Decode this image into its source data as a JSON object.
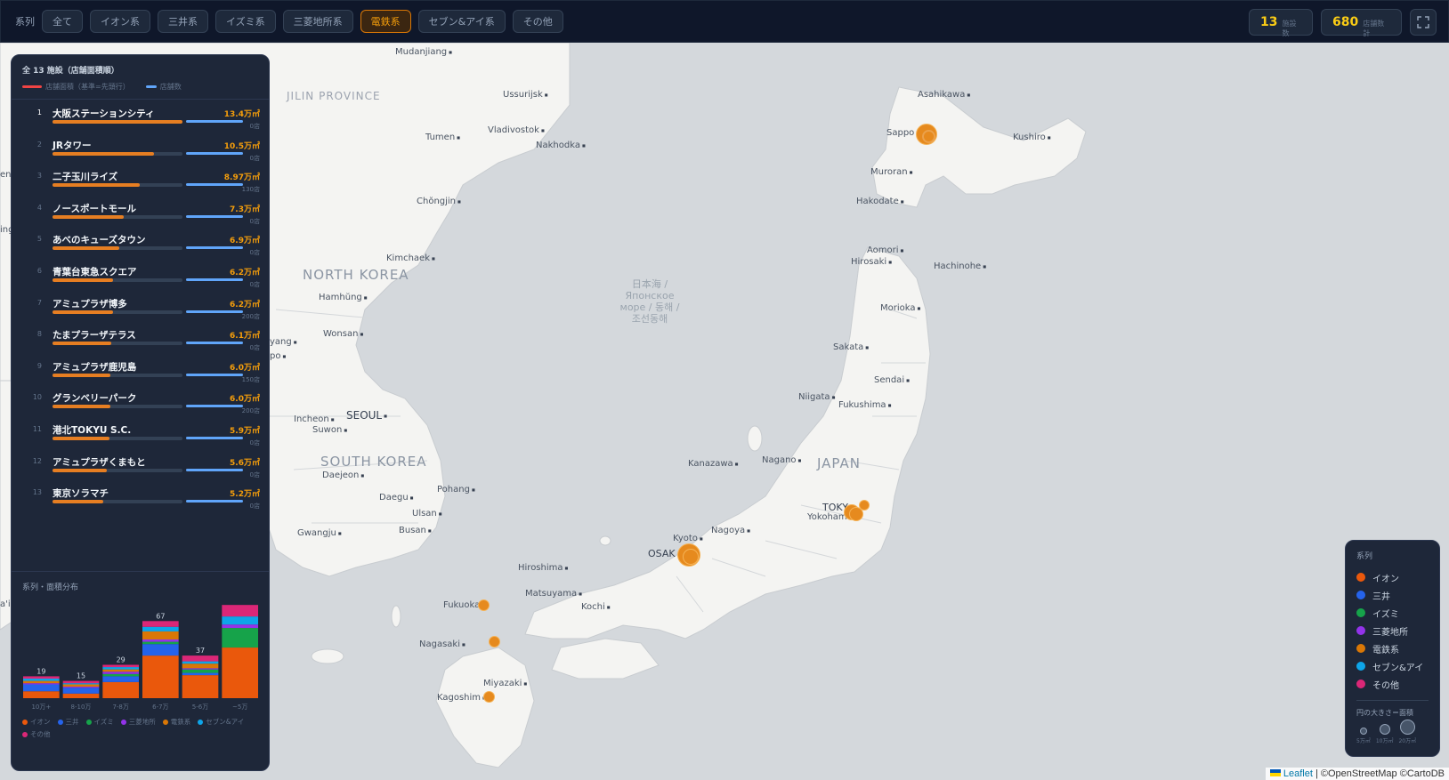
{
  "toolbar": {
    "series_label": "系列",
    "filters": [
      "全て",
      "イオン系",
      "三井系",
      "イズミ系",
      "三菱地所系",
      "電鉄系",
      "セブン&アイ系",
      "その他"
    ],
    "active_filter": "電鉄系",
    "facilities_value": "13",
    "facilities_unit": "施設数",
    "shops_value": "680",
    "shops_unit": "店舗数計",
    "fullscreen_icon": "fullscreen-icon"
  },
  "panel": {
    "title": "全 13 施設（店舗面積順）",
    "legend_area": "店舗面積（基準=先頭行）",
    "legend_shops": "店舗数",
    "items": [
      {
        "rank": "1",
        "name": "大阪ステーションシティ",
        "area": "13.4万㎡",
        "shops": "0店",
        "area_value": 13.4
      },
      {
        "rank": "2",
        "name": "JRタワー",
        "area": "10.5万㎡",
        "shops": "0店",
        "area_value": 10.5
      },
      {
        "rank": "3",
        "name": "二子玉川ライズ",
        "area": "8.97万㎡",
        "shops": "130店",
        "area_value": 8.97
      },
      {
        "rank": "4",
        "name": "ノースポートモール",
        "area": "7.3万㎡",
        "shops": "0店",
        "area_value": 7.3
      },
      {
        "rank": "5",
        "name": "あべのキューズタウン",
        "area": "6.9万㎡",
        "shops": "0店",
        "area_value": 6.9
      },
      {
        "rank": "6",
        "name": "青葉台東急スクエア",
        "area": "6.2万㎡",
        "shops": "0店",
        "area_value": 6.2
      },
      {
        "rank": "7",
        "name": "アミュプラザ博多",
        "area": "6.2万㎡",
        "shops": "200店",
        "area_value": 6.2
      },
      {
        "rank": "8",
        "name": "たまプラーザテラス",
        "area": "6.1万㎡",
        "shops": "0店",
        "area_value": 6.1
      },
      {
        "rank": "9",
        "name": "アミュプラザ鹿児島",
        "area": "6.0万㎡",
        "shops": "150店",
        "area_value": 6.0
      },
      {
        "rank": "10",
        "name": "グランベリーパーク",
        "area": "6.0万㎡",
        "shops": "200店",
        "area_value": 6.0
      },
      {
        "rank": "11",
        "name": "港北TOKYU S.C.",
        "area": "5.9万㎡",
        "shops": "0店",
        "area_value": 5.9
      },
      {
        "rank": "12",
        "name": "アミュプラザくまもと",
        "area": "5.6万㎡",
        "shops": "0店",
        "area_value": 5.6
      },
      {
        "rank": "13",
        "name": "東京ソラマチ",
        "area": "5.2万㎡",
        "shops": "0店",
        "area_value": 5.2
      }
    ],
    "dist_title": "系列・面積分布"
  },
  "chart_data": {
    "type": "bar",
    "stacked": true,
    "categories": [
      "10万+",
      "8-10万",
      "7-8万",
      "6-7万",
      "5-6万",
      "~5万"
    ],
    "totals": [
      19,
      15,
      29,
      67,
      37,
      null
    ],
    "total_labels": [
      "19",
      "15",
      "29",
      "67",
      "37",
      ""
    ],
    "series": [
      {
        "name": "イオン",
        "color": "#ea580c",
        "values": [
          6,
          4,
          14,
          37,
          20,
          44
        ]
      },
      {
        "name": "三井",
        "color": "#2563eb",
        "values": [
          6,
          5,
          5,
          10,
          2,
          0
        ]
      },
      {
        "name": "イズミ",
        "color": "#16a34a",
        "values": [
          0,
          0,
          2,
          2,
          3,
          17
        ]
      },
      {
        "name": "三菱地所",
        "color": "#9333ea",
        "values": [
          1,
          1,
          2,
          2,
          1,
          3
        ]
      },
      {
        "name": "電鉄系",
        "color": "#d97706",
        "values": [
          2,
          2,
          2,
          7,
          4,
          0
        ]
      },
      {
        "name": "セブン&アイ",
        "color": "#0ea5e9",
        "values": [
          2,
          1,
          2,
          4,
          2,
          7
        ]
      },
      {
        "name": "その他",
        "color": "#db2777",
        "values": [
          2,
          2,
          2,
          5,
          5,
          10
        ]
      }
    ],
    "ylim": [
      0,
      85
    ]
  },
  "legend": {
    "title": "系列",
    "items": [
      {
        "label": "イオン",
        "color": "#ea580c"
      },
      {
        "label": "三井",
        "color": "#2563eb"
      },
      {
        "label": "イズミ",
        "color": "#16a34a"
      },
      {
        "label": "三菱地所",
        "color": "#9333ea"
      },
      {
        "label": "電鉄系",
        "color": "#d97706"
      },
      {
        "label": "セブン&アイ",
        "color": "#0ea5e9"
      },
      {
        "label": "その他",
        "color": "#db2777"
      }
    ],
    "size_title": "円の大きさ＝面積",
    "sizes": [
      "5万㎡",
      "10万㎡",
      "20万㎡"
    ]
  },
  "map": {
    "cities": [
      "Mudanjiang",
      "Ussurijsk",
      "Vladivostok",
      "Nakhodka",
      "Tumen",
      "Chŏngjin",
      "Kimchaek",
      "Hamhŭng",
      "Wonsan",
      "Incheon",
      "SEOUL",
      "Suwon",
      "Daejeon",
      "Pohang",
      "Daegu",
      "Ulsan",
      "Gwangju",
      "Busan",
      "Asahikawa",
      "Sappo",
      "Kushiro",
      "Muroran",
      "Hakodate",
      "Aomori",
      "Hirosaki",
      "Hachinohe",
      "Morioka",
      "Sakata",
      "Sendai",
      "Niigata",
      "Fukushima",
      "Kanazawa",
      "Nagano",
      "TOKY",
      "Yokoham",
      "Kyoto",
      "OSAK",
      "Nagoya",
      "Hiroshima",
      "Matsuyama",
      "Kochi",
      "Fukuoka",
      "Nagasaki",
      "Miyazaki",
      "Kagoshim"
    ],
    "regions": [
      "JILIN PROVINCE",
      "NORTH KOREA",
      "SOUTH KOREA",
      "JAPAN"
    ],
    "sea_label": "日本海 / Японское море / 동해 / 조선동해",
    "partial_labels": [
      "ener",
      "ing",
      "yang",
      "po",
      "a'i",
      "D",
      "VIN",
      "nsa"
    ]
  },
  "attribution": {
    "leaflet": "Leaflet",
    "rest": "| ©OpenStreetMap ©CartoDB"
  }
}
